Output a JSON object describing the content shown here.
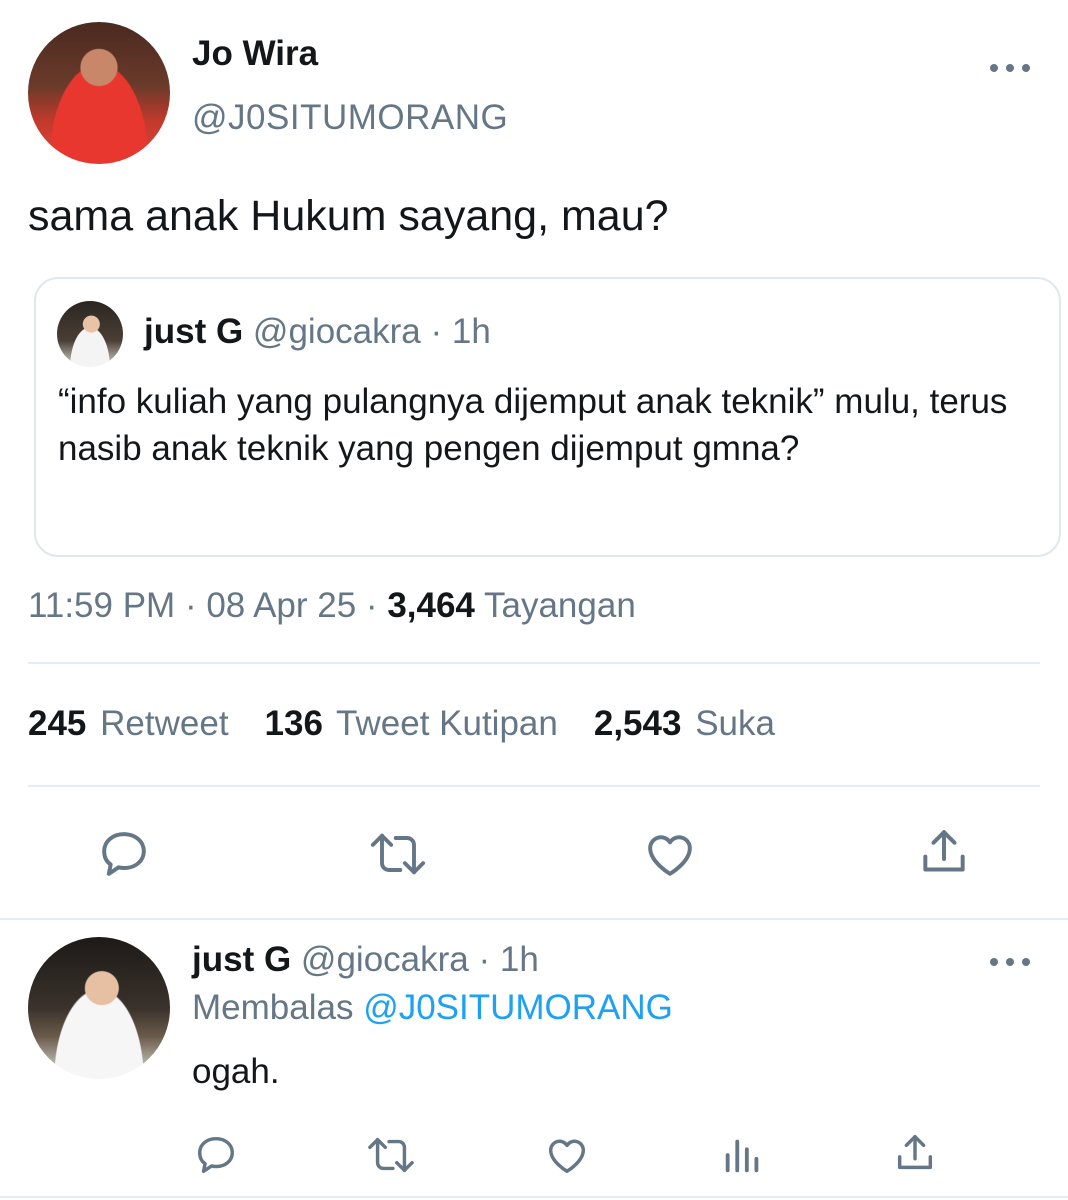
{
  "main_tweet": {
    "display_name": "Jo Wira",
    "handle": "@J0SITUMORANG",
    "text": "sama anak Hukum sayang, mau?",
    "quoted": {
      "display_name": "just G",
      "handle": "@giocakra",
      "time": "1h",
      "text": "“info kuliah yang pulangnya dijemput anak teknik” mulu, terus nasib anak teknik yang pengen dijemput gmna?"
    },
    "time": "11:59 PM",
    "date": "08 Apr 25",
    "views_count": "3,464",
    "views_label": "Tayangan",
    "stats": {
      "retweets_count": "245",
      "retweets_label": "Retweet",
      "quotes_count": "136",
      "quotes_label": "Tweet Kutipan",
      "likes_count": "2,543",
      "likes_label": "Suka"
    }
  },
  "reply": {
    "display_name": "just G",
    "handle": "@giocakra",
    "time": "1h",
    "replying_label": "Membalas",
    "replying_to": "@J0SITUMORANG",
    "text": "ogah."
  },
  "icons": {
    "more": "more-icon",
    "reply": "reply-icon",
    "retweet": "retweet-icon",
    "like": "heart-icon",
    "analytics": "analytics-icon",
    "share": "share-icon"
  },
  "colors": {
    "primary_text": "#14171a",
    "secondary_text": "#657786",
    "link": "#1da1f2",
    "divider": "#e6ecf0"
  }
}
